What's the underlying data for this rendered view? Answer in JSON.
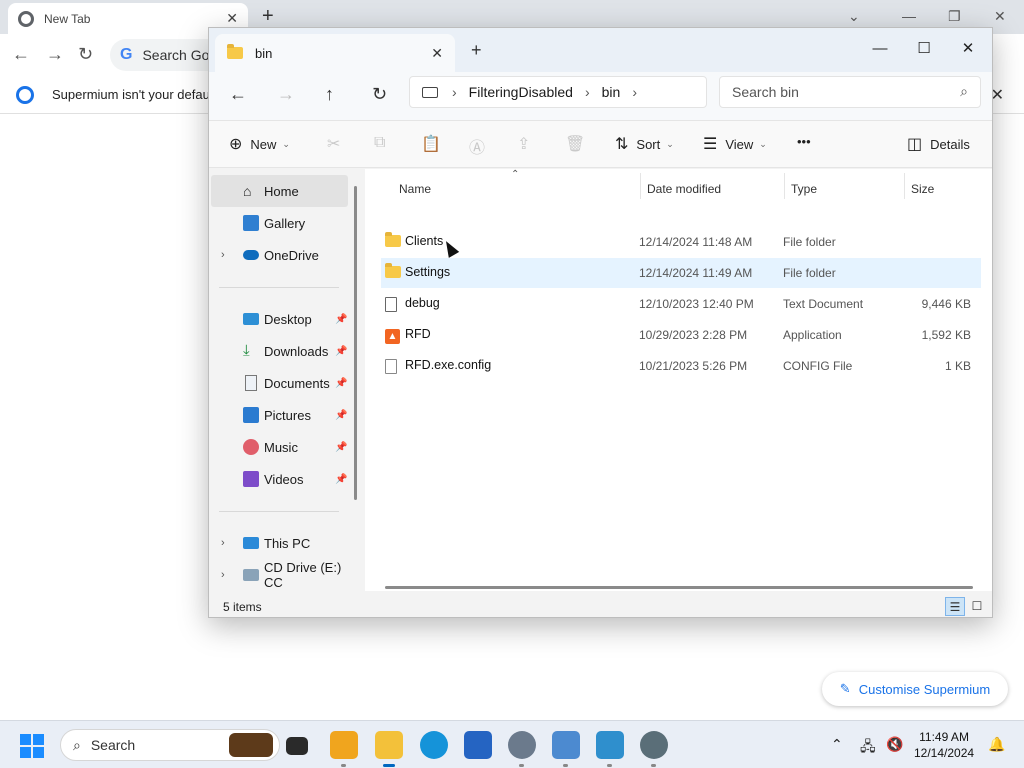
{
  "browser": {
    "tab_title": "New Tab",
    "omnibox_text": "Search Goo",
    "infobar_text": "Supermium isn't your defau",
    "customise_label": "Customise Supermium"
  },
  "explorer": {
    "tab_title": "bin",
    "breadcrumb": [
      "FilteringDisabled",
      "bin"
    ],
    "search_placeholder": "Search bin",
    "toolbar": {
      "new_label": "New",
      "sort_label": "Sort",
      "view_label": "View",
      "more_label": "•••",
      "details_label": "Details"
    },
    "nav": {
      "home": "Home",
      "gallery": "Gallery",
      "onedrive": "OneDrive",
      "desktop": "Desktop",
      "downloads": "Downloads",
      "documents": "Documents",
      "pictures": "Pictures",
      "music": "Music",
      "videos": "Videos",
      "thispc": "This PC",
      "cddrive": "CD Drive (E:) CC"
    },
    "columns": {
      "name": "Name",
      "date": "Date modified",
      "type": "Type",
      "size": "Size"
    },
    "files": [
      {
        "name": "Clients",
        "date": "12/14/2024 11:48 AM",
        "type": "File folder",
        "size": "",
        "icon": "folder-icon"
      },
      {
        "name": "Settings",
        "date": "12/14/2024 11:49 AM",
        "type": "File folder",
        "size": "",
        "icon": "folder-icon"
      },
      {
        "name": "debug",
        "date": "12/10/2023 12:40 PM",
        "type": "Text Document",
        "size": "9,446 KB",
        "icon": "text-document-icon"
      },
      {
        "name": "RFD",
        "date": "10/29/2023 2:28 PM",
        "type": "Application",
        "size": "1,592 KB",
        "icon": "application-icon"
      },
      {
        "name": "RFD.exe.config",
        "date": "10/21/2023 5:26 PM",
        "type": "CONFIG File",
        "size": "1 KB",
        "icon": "config-file-icon"
      }
    ],
    "status_text": "5 items"
  },
  "taskbar": {
    "search_label": "Search",
    "time": "11:49 AM",
    "date": "12/14/2024"
  }
}
